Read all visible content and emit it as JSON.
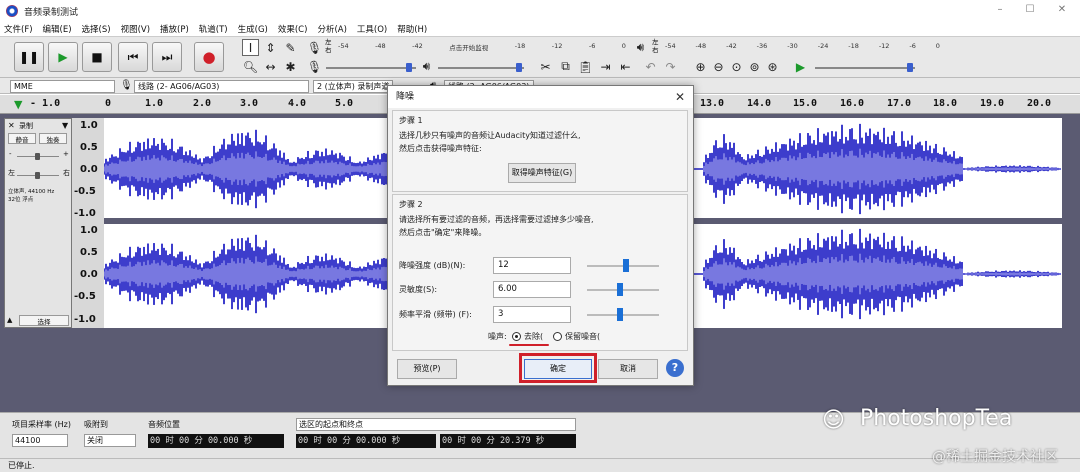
{
  "window": {
    "title": "音频录制测试",
    "min": "–",
    "max": "☐",
    "close": "✕"
  },
  "menu": [
    "文件(F)",
    "编辑(E)",
    "选择(S)",
    "视图(V)",
    "播放(P)",
    "轨道(T)",
    "生成(G)",
    "效果(C)",
    "分析(A)",
    "工具(O)",
    "帮助(H)"
  ],
  "transport": {
    "pause": "pause-icon",
    "play": "play-icon",
    "stop": "stop-icon",
    "skip_start": "skip-start-icon",
    "skip_end": "skip-end-icon",
    "record": "record-icon"
  },
  "meter": {
    "record_ticks": [
      "-54",
      "-48",
      "-42",
      "点击开始监视",
      "-18",
      "-12",
      "-6",
      "0"
    ],
    "play_ticks": [
      "-54",
      "-48",
      "-42",
      "-36",
      "-30",
      "-24",
      "-18",
      "-12",
      "-6",
      "0"
    ],
    "lr": [
      "左",
      "右"
    ]
  },
  "device": {
    "host": "MME",
    "rec_device": "线路 (2- AG06/AG03)",
    "channels": "2 (立体声) 录制声道",
    "play_device": "线路 (2- AG06/AG03)"
  },
  "ruler": {
    "ticks": [
      "0",
      "1.0",
      "2.0",
      "3.0",
      "4.0",
      "5.0",
      "13.0",
      "14.0",
      "15.0",
      "16.0",
      "17.0",
      "18.0",
      "19.0",
      "20.0"
    ],
    "lead": "- 1.0"
  },
  "track": {
    "name": "录制",
    "mute": "静音",
    "solo": "独奏",
    "gain_l": "-",
    "gain_r": "+",
    "pan_l": "左",
    "pan_r": "右",
    "info1": "立体声, 44100 Hz",
    "info2": "32位 浮点",
    "select": "选择",
    "yaxis": [
      "1.0",
      "0.5",
      "0.0",
      "-0.5",
      "-1.0"
    ]
  },
  "dialog": {
    "title": "降噪",
    "step1_title": "步骤 1",
    "step1_line1": "选择几秒只有噪声的音频让Audacity知道过滤什么,",
    "step1_line2": "然后点击获得噪声特征:",
    "get_profile": "取得噪声特征(G)",
    "step2_title": "步骤 2",
    "step2_line1": "请选择所有要过滤的音频，再选择需要过滤掉多少噪音,",
    "step2_line2": "然后点击\"确定\"来降噪。",
    "params": [
      {
        "label": "降噪强度 (dB)(N):",
        "value": "12",
        "level": 0.55
      },
      {
        "label": "灵敏度(S):",
        "value": "6.00",
        "level": 0.45
      },
      {
        "label": "频率平滑 (频带) (F):",
        "value": "3",
        "level": 0.45
      }
    ],
    "noise_label": "噪声:",
    "opt_remove": "去除(",
    "opt_keep": "保留噪音(",
    "preview": "预览(P)",
    "ok": "确定",
    "cancel": "取消",
    "help": "?"
  },
  "bottom": {
    "rate_label": "项目采样率 (Hz)",
    "rate_value": "44100",
    "snap_label": "吸附到",
    "snap_value": "关闭",
    "pos_label": "音频位置",
    "pos_value": "00 时 00 分 00.000 秒",
    "sel_label": "选区的起点和终点",
    "sel_start": "00 时 00 分 00.000 秒",
    "sel_end": "00 时 00 分 20.379 秒"
  },
  "status": "已停止.",
  "watermark": {
    "main": "PhotoshopTea",
    "sub": "@稀土掘金技术社区"
  },
  "colors": {
    "wave": "#3d3dcc",
    "wave_rms": "#7878e0",
    "track_bg": "#5b5b72",
    "highlight": "#d0202a"
  }
}
